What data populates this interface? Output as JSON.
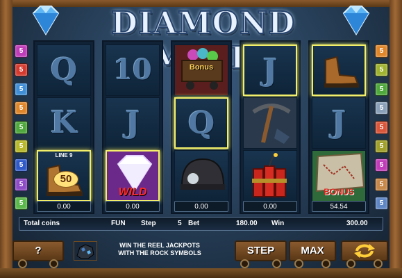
{
  "title": "DIAMOND MINE",
  "line_indicators": {
    "left": [
      {
        "label": "5",
        "color": "#c03bb8"
      },
      {
        "label": "5",
        "color": "#d63a2e"
      },
      {
        "label": "5",
        "color": "#3f8ed6"
      },
      {
        "label": "5",
        "color": "#e0862a"
      },
      {
        "label": "5",
        "color": "#4ea83b"
      },
      {
        "label": "5",
        "color": "#b8b82a"
      },
      {
        "label": "5",
        "color": "#2f59c9"
      },
      {
        "label": "5",
        "color": "#8e4bc7"
      },
      {
        "label": "5",
        "color": "#5bb84a"
      }
    ],
    "right": [
      {
        "label": "5",
        "color": "#e0862a"
      },
      {
        "label": "5",
        "color": "#9fb22f"
      },
      {
        "label": "5",
        "color": "#4ea83b"
      },
      {
        "label": "5",
        "color": "#8aa0b8"
      },
      {
        "label": "5",
        "color": "#d9563a"
      },
      {
        "label": "5",
        "color": "#a0a02a"
      },
      {
        "label": "5",
        "color": "#c03bb8"
      },
      {
        "label": "5",
        "color": "#c7884a"
      },
      {
        "label": "5",
        "color": "#5f86c4"
      }
    ]
  },
  "reels": [
    {
      "cells": [
        {
          "symbol": "Q"
        },
        {
          "symbol": "K"
        },
        {
          "symbol": "boot-50-icon",
          "caption": "LINE 9",
          "badge": "50",
          "highlight": true
        }
      ],
      "win": "0.00"
    },
    {
      "cells": [
        {
          "symbol": "10"
        },
        {
          "symbol": "J"
        },
        {
          "symbol": "wild-diamond-icon",
          "label": "WILD",
          "highlight": true
        }
      ],
      "win": "0.00"
    },
    {
      "cells": [
        {
          "symbol": "bonus-cart-icon",
          "label": "Bonus"
        },
        {
          "symbol": "Q",
          "highlight": true
        },
        {
          "symbol": "miner-helmet-icon"
        }
      ],
      "win": "0.00"
    },
    {
      "cells": [
        {
          "symbol": "J",
          "highlight": true
        },
        {
          "symbol": "pickaxe-icon"
        },
        {
          "symbol": "dynamite-icon"
        }
      ],
      "win": "0.00"
    },
    {
      "cells": [
        {
          "symbol": "boot-icon",
          "highlight": true
        },
        {
          "symbol": "J"
        },
        {
          "symbol": "bonus-map-icon",
          "label": "BONUS"
        }
      ],
      "win": "54.54"
    }
  ],
  "info": {
    "total_coins_label": "Total coins",
    "fun_label": "FUN",
    "step_label": "Step",
    "bet_value": "5",
    "bet_label": "Bet",
    "amount": "180.00",
    "win_label": "Win",
    "win_value": "300.00"
  },
  "controls": {
    "help_label": "?",
    "step_label": "STEP",
    "max_label": "MAX",
    "spin_icon": "spin-arrows-icon"
  },
  "promo_text": "WIN THE REEL JACKPOTS WITH THE ROCK SYMBOLS"
}
